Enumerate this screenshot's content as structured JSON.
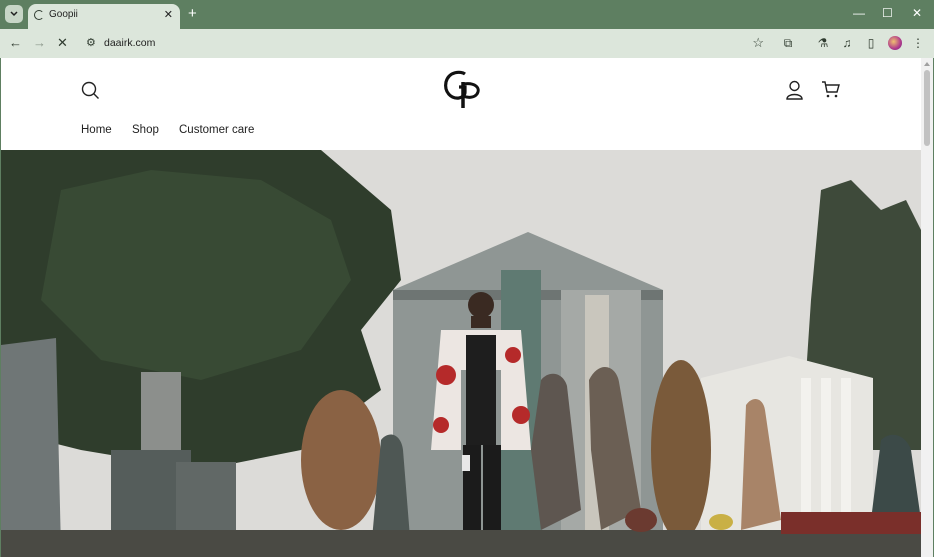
{
  "browser": {
    "tab_title": "Goopii",
    "url": "daairk.com"
  },
  "site": {
    "logo_text": "GP",
    "nav": [
      "Home",
      "Shop",
      "Customer care"
    ]
  },
  "colors": {
    "chrome_frame": "#5e7f61",
    "chrome_toolbar": "#dce6db",
    "page_bg": "#ffffff"
  }
}
